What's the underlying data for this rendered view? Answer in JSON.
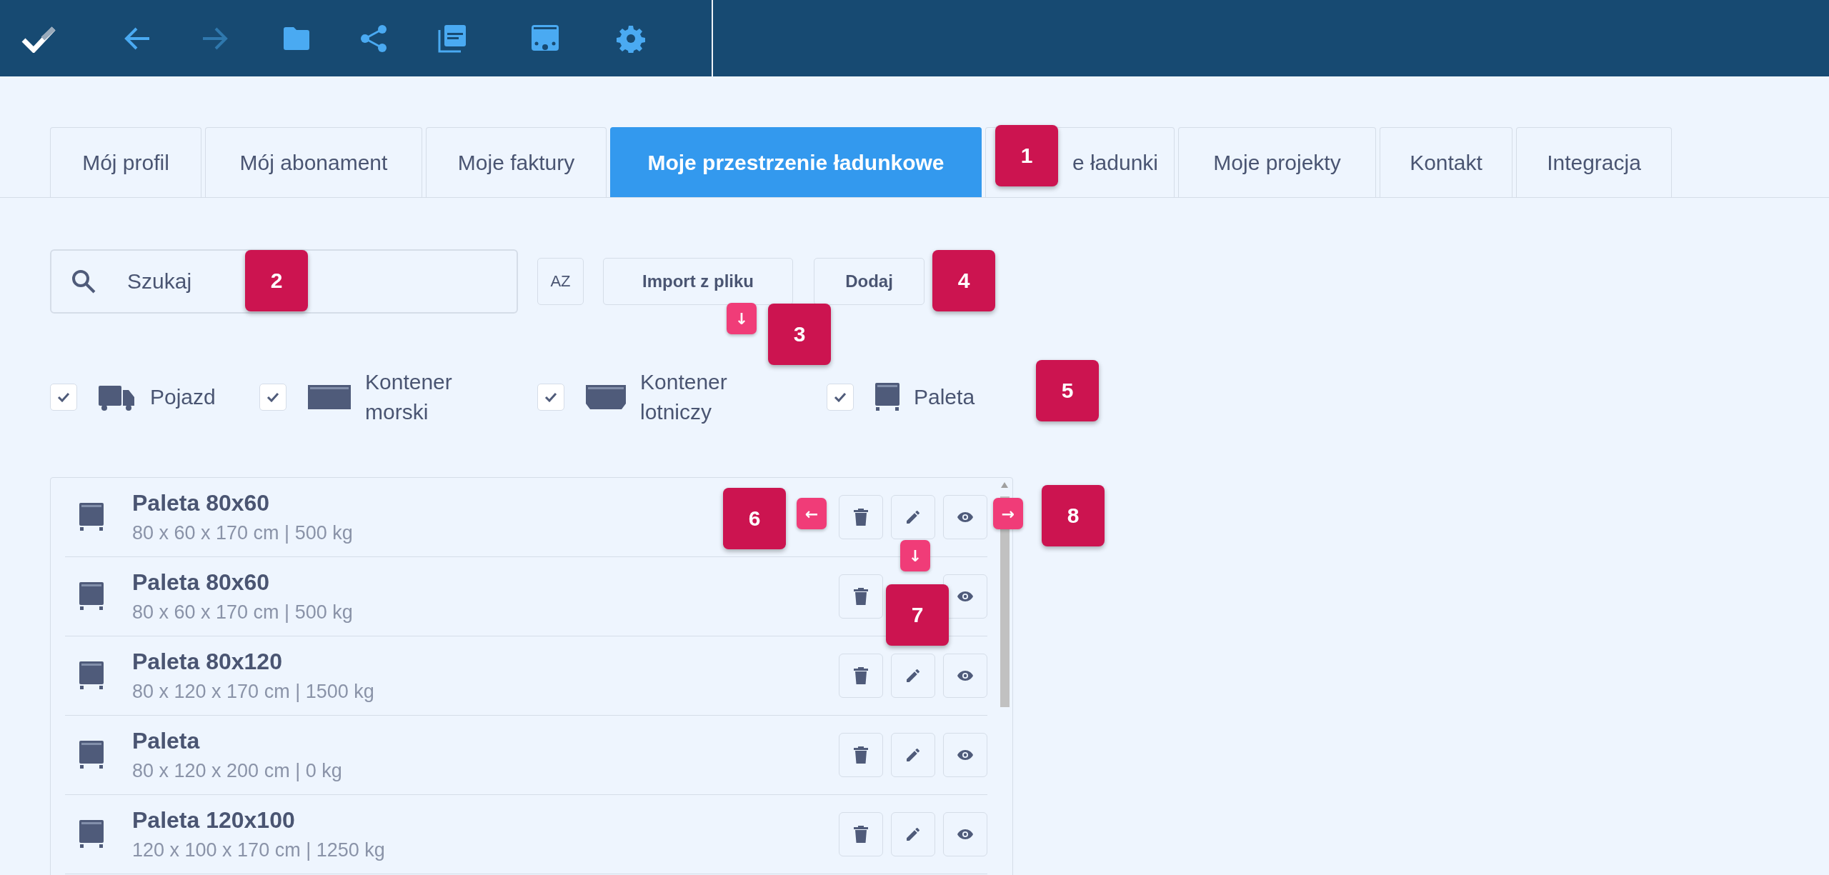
{
  "nav": [
    {
      "kind": "back",
      "disabled": false
    },
    {
      "kind": "forward",
      "disabled": true
    }
  ],
  "tabs": [
    {
      "label": "Mój profil",
      "selected": false
    },
    {
      "label": "Mój abonament",
      "selected": false
    },
    {
      "label": "Moje faktury",
      "selected": false
    },
    {
      "label": "Moje przestrzenie ładunkowe",
      "selected": true
    },
    {
      "label": "e ładunki",
      "selected": false
    },
    {
      "label": "Moje projekty",
      "selected": false
    },
    {
      "label": "Kontakt",
      "selected": false
    },
    {
      "label": "Integracja",
      "selected": false
    }
  ],
  "search": {
    "placeholder": "Szukaj"
  },
  "sort_label": "AZ",
  "buttons": [
    "Import z pliku",
    "Dodaj"
  ],
  "filters": [
    {
      "kind": "vehicle",
      "label": "Pojazd",
      "checked": true
    },
    {
      "kind": "sea_container",
      "label": "Kontener morski",
      "checked": true
    },
    {
      "kind": "air_container",
      "label": "Kontener lotniczy",
      "checked": true
    },
    {
      "kind": "pallet",
      "label": "Paleta",
      "checked": true
    }
  ],
  "items": [
    {
      "kind": "pallet",
      "title": "Paleta 80x60",
      "details": "80 x 60 x 170 cm | 500 kg",
      "actions": [
        {
          "kind": "delete"
        },
        {
          "kind": "edit"
        },
        {
          "kind": "view"
        }
      ]
    },
    {
      "kind": "pallet",
      "title": "Paleta 80x60",
      "details": "80 x 60 x 170 cm | 500 kg",
      "actions": [
        {
          "kind": "delete"
        },
        {
          "kind": "view"
        }
      ]
    },
    {
      "kind": "pallet",
      "title": "Paleta 80x120",
      "details": "80 x 120 x 170 cm | 1500 kg",
      "actions": [
        {
          "kind": "delete"
        },
        {
          "kind": "edit"
        },
        {
          "kind": "view"
        }
      ]
    },
    {
      "kind": "pallet",
      "title": "Paleta",
      "details": "80 x 120 x 200 cm | 0 kg",
      "actions": [
        {
          "kind": "delete"
        },
        {
          "kind": "edit"
        },
        {
          "kind": "view"
        }
      ]
    },
    {
      "kind": "pallet",
      "title": "Paleta 120x100",
      "details": "120 x 100 x 170 cm | 1250 kg",
      "actions": [
        {
          "kind": "delete"
        },
        {
          "kind": "edit"
        },
        {
          "kind": "view"
        }
      ]
    }
  ],
  "callouts": [
    {
      "number": "1"
    },
    {
      "number": "2"
    },
    {
      "number": "3"
    },
    {
      "number": "4"
    },
    {
      "number": "5"
    },
    {
      "number": "6"
    },
    {
      "number": "7"
    },
    {
      "number": "8"
    }
  ],
  "markers": [
    {
      "symbol": "↓"
    },
    {
      "symbol": "←"
    },
    {
      "symbol": "↓"
    },
    {
      "symbol": "→"
    }
  ]
}
